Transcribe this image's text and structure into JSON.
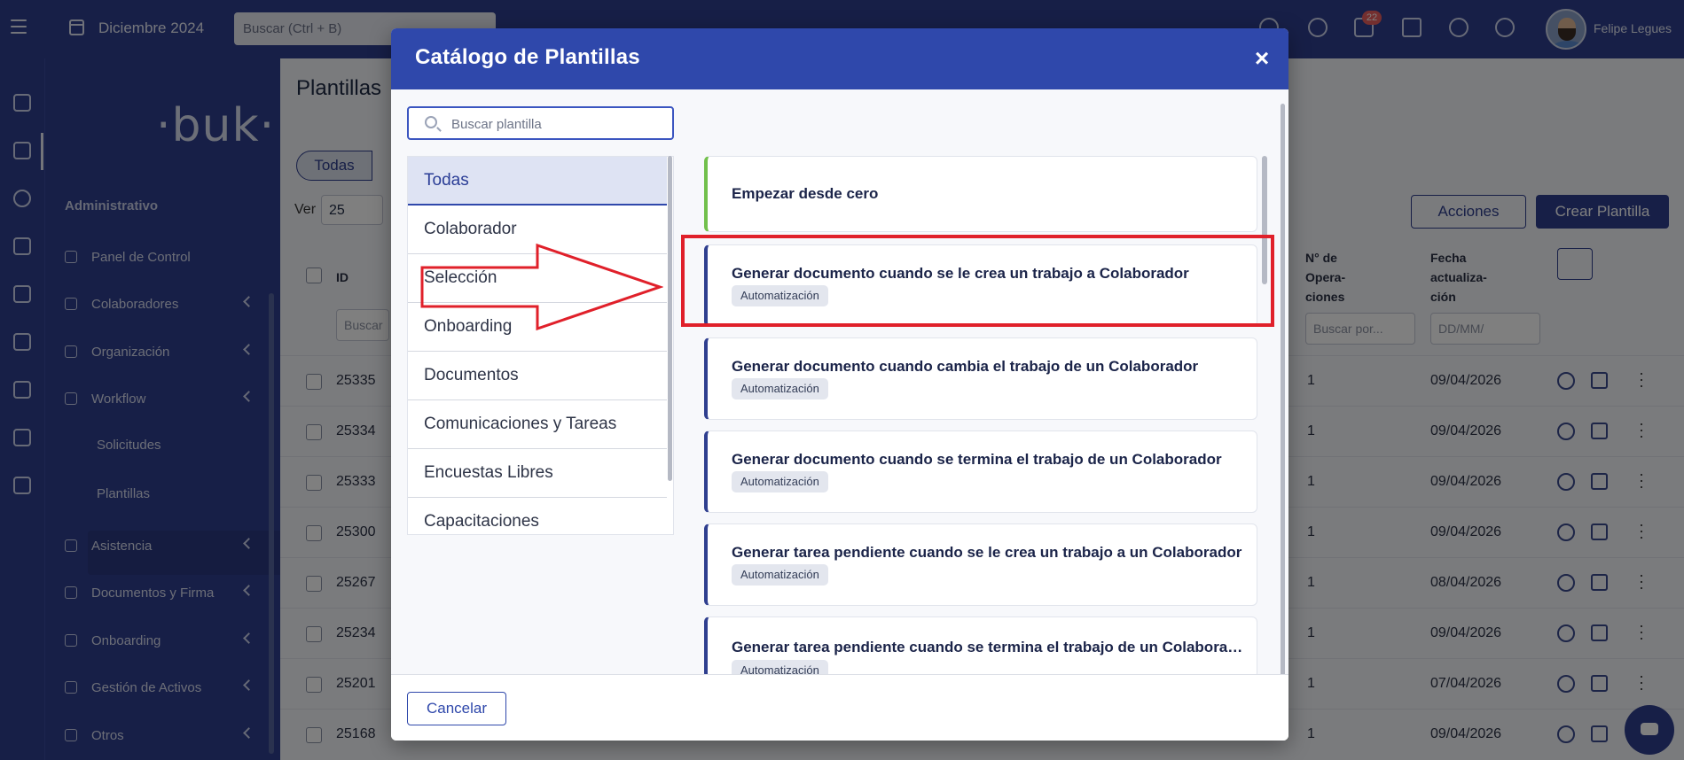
{
  "topbar": {
    "month": "Diciembre 2024",
    "search_placeholder": "Buscar (Ctrl + B)",
    "notifications_count": "22",
    "username": "Felipe Legues"
  },
  "sidebar": {
    "logo": "·buk·",
    "section": "Administrativo",
    "items": [
      {
        "label": "Panel de Control",
        "icon": "dashboard-icon"
      },
      {
        "label": "Colaboradores",
        "icon": "users-icon"
      },
      {
        "label": "Organización",
        "icon": "org-chart-icon"
      },
      {
        "label": "Workflow",
        "icon": "workflow-icon"
      },
      {
        "label": "Asistencia",
        "icon": "calendar-check-icon"
      },
      {
        "label": "Documentos y Firma",
        "icon": "documents-icon"
      },
      {
        "label": "Onboarding",
        "icon": "onboarding-icon"
      },
      {
        "label": "Gestión de Activos",
        "icon": "clipboard-icon"
      },
      {
        "label": "Otros",
        "icon": "grid-icon"
      }
    ],
    "sub_items": [
      "Solicitudes",
      "Plantillas"
    ]
  },
  "background_page": {
    "title": "Plantillas",
    "filter_active": "Todas",
    "ver_label": "Ver",
    "ver_value": "25",
    "acciones_label": "Acciones",
    "crear_label": "Crear Plantilla",
    "col_id": "ID",
    "col_ops_1": "N° de",
    "col_ops_2": "Opera-",
    "col_ops_3": "ciones",
    "col_date_1": "Fecha",
    "col_date_2": "actualiza-",
    "col_date_3": "ción",
    "search_placeholder": "Buscar",
    "ops_placeholder": "Buscar por...",
    "date_placeholder": "DD/MM/",
    "rows": [
      {
        "id": "25335",
        "ops": "1",
        "date": "09/04/2026"
      },
      {
        "id": "25334",
        "ops": "1",
        "date": "09/04/2026"
      },
      {
        "id": "25333",
        "ops": "1",
        "date": "09/04/2026"
      },
      {
        "id": "25300",
        "ops": "1",
        "date": "09/04/2026"
      },
      {
        "id": "25267",
        "ops": "1",
        "date": "08/04/2026"
      },
      {
        "id": "25234",
        "ops": "1",
        "date": "09/04/2026"
      },
      {
        "id": "25201",
        "ops": "1",
        "date": "07/04/2026"
      },
      {
        "id": "25168",
        "ops": "1",
        "date": "09/04/2026"
      }
    ]
  },
  "modal": {
    "title": "Catálogo de Plantillas",
    "close_label": "×",
    "search_placeholder": "Buscar plantilla",
    "categories": [
      "Todas",
      "Colaborador",
      "Selección",
      "Onboarding",
      "Documentos",
      "Comunicaciones y Tareas",
      "Encuestas Libres",
      "Capacitaciones"
    ],
    "templates": [
      {
        "title": "Empezar desde cero",
        "badge": ""
      },
      {
        "title": "Generar documento cuando se le crea un trabajo a Colaborador",
        "badge": "Automatización"
      },
      {
        "title": "Generar documento cuando cambia el trabajo de un Colaborador",
        "badge": "Automatización"
      },
      {
        "title": "Generar documento cuando se termina el trabajo de un Colaborador",
        "badge": "Automatización"
      },
      {
        "title": "Generar tarea pendiente cuando se le crea un trabajo a un Colaborador",
        "badge": "Automatización"
      },
      {
        "title": "Generar tarea pendiente cuando se termina el trabajo de un Colaborador",
        "badge": "Automatización"
      }
    ],
    "cancel_label": "Cancelar"
  },
  "colors": {
    "brand": "#2f3f8f",
    "modal_header": "#2f48ab",
    "annotation_red": "#e0202a",
    "start_accent": "#72c04c"
  }
}
